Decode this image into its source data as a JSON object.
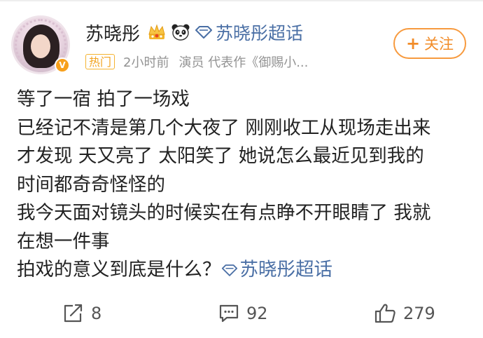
{
  "author": {
    "name": "苏晓彤",
    "verified_badge": "V",
    "badges": [
      "crown-icon",
      "panda-icon"
    ],
    "topic_label": "苏晓彤超话"
  },
  "meta": {
    "hot_label": "热门",
    "time": "2小时前",
    "description": "演员 代表作《御赐小..."
  },
  "follow": {
    "plus": "+",
    "label": "关注"
  },
  "post": {
    "lines": [
      "等了一宿 拍了一场戏",
      "已经记不清是第几个大夜了 刚刚收工从现场走出来",
      "才发现 天又亮了 太阳笑了 她说怎么最近见到我的",
      "时间都奇奇怪怪的",
      "我今天面对镜头的时候实在有点睁不开眼睛了 我就",
      "在想一件事",
      "拍戏的意义到底是什么？"
    ],
    "topic_tag": "苏晓彤超话"
  },
  "actions": {
    "reposts": "8",
    "comments": "92",
    "likes": "279"
  },
  "colors": {
    "link": "#4a6fa5",
    "accent": "#f28c28",
    "hot": "#f2a31f",
    "meta": "#939393"
  }
}
